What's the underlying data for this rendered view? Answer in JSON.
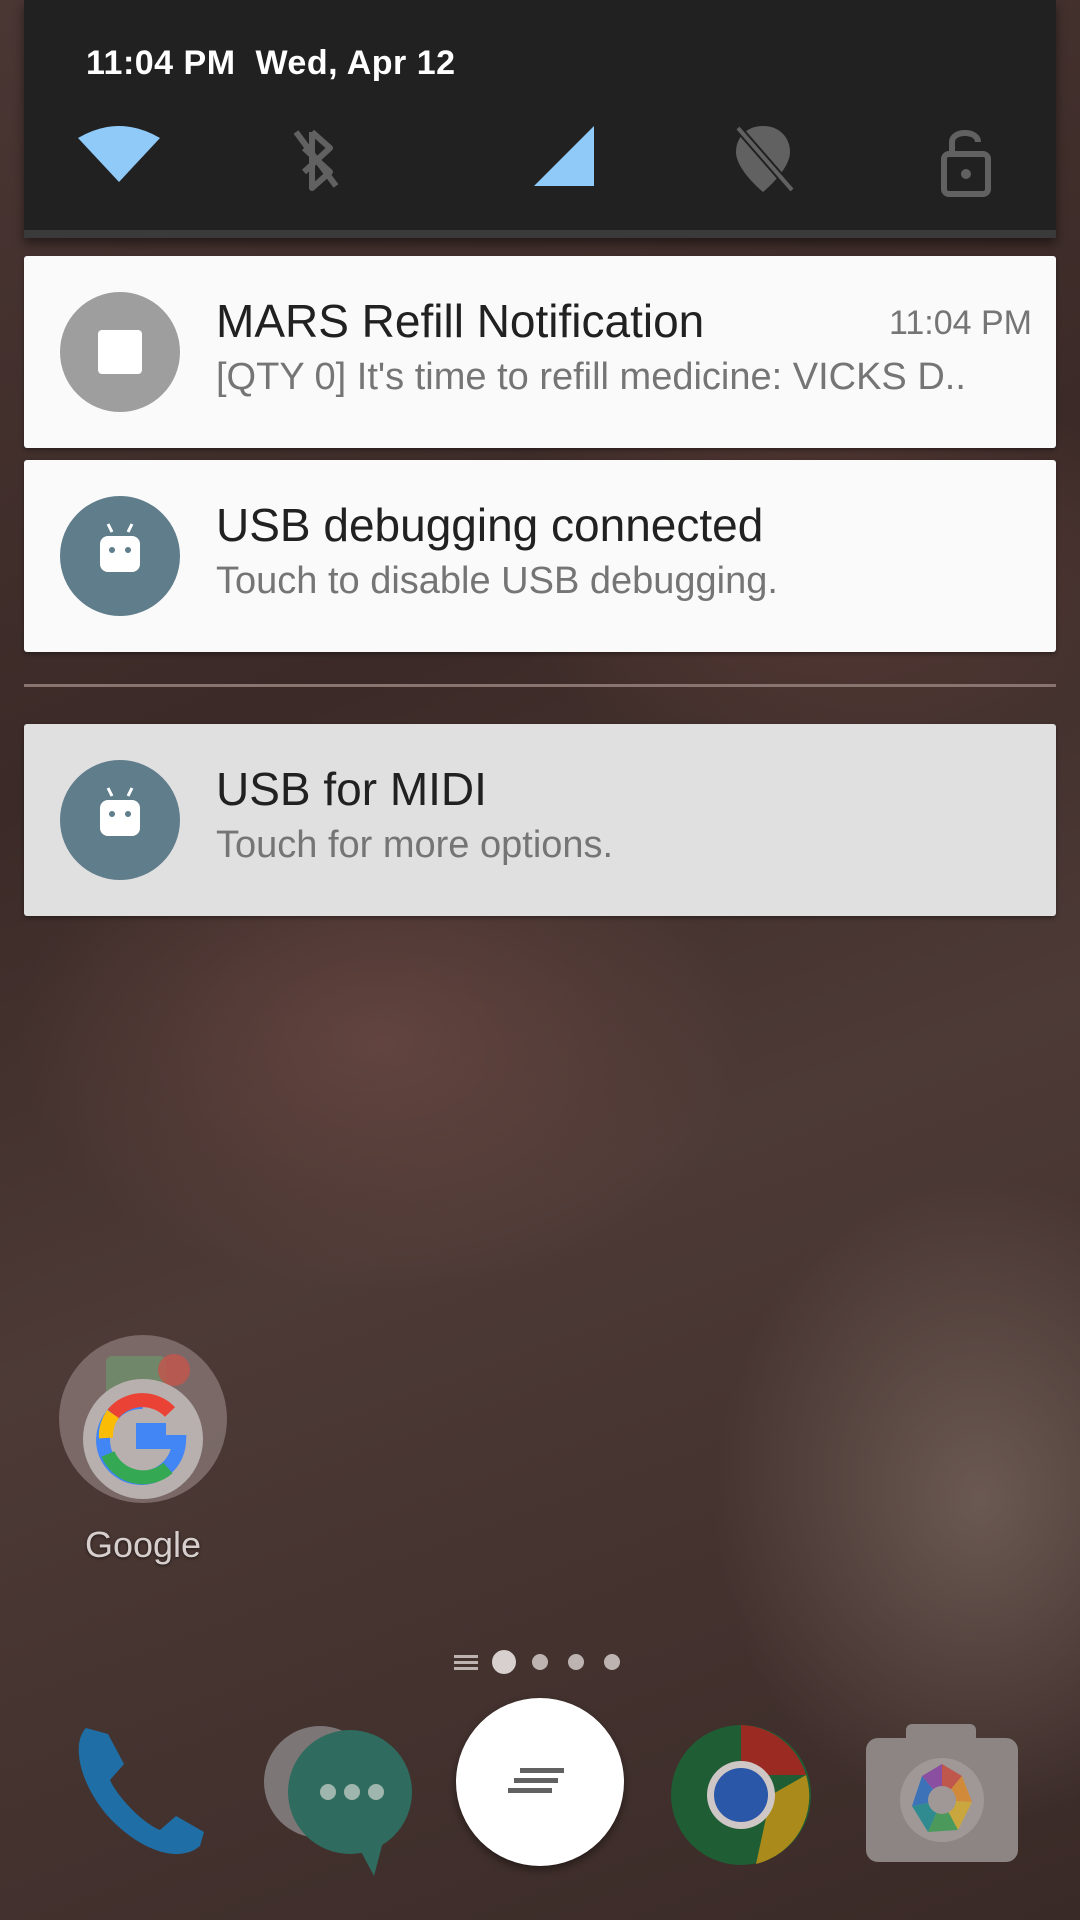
{
  "status_header": {
    "time": "11:04 PM",
    "date": "Wed, Apr 12"
  },
  "quick_settings": [
    {
      "name": "wifi-icon",
      "state": "on"
    },
    {
      "name": "bluetooth-off-icon",
      "state": "off"
    },
    {
      "name": "cellular-signal-icon",
      "state": "on"
    },
    {
      "name": "location-off-icon",
      "state": "off"
    },
    {
      "name": "lock-icon",
      "state": "off"
    }
  ],
  "notifications": [
    {
      "title": "MARS Refill Notification",
      "body": "[QTY 0] It's time to refill medicine: VICKS D..",
      "time": "11:04 PM",
      "icon": "stop-icon",
      "icon_color": "#9e9e9e"
    },
    {
      "title": "USB debugging connected",
      "body": "Touch to disable USB debugging.",
      "icon": "android-icon",
      "icon_color": "#607d8b"
    },
    {
      "title": "USB for MIDI",
      "body": "Touch for more options.",
      "icon": "android-icon",
      "icon_color": "#607d8b"
    }
  ],
  "home": {
    "folder_label": "Google",
    "page_indicator": {
      "pages": 4,
      "current": 1
    },
    "dock": [
      {
        "name": "phone-icon"
      },
      {
        "name": "messenger-icon"
      },
      {
        "name": "app-drawer-icon"
      },
      {
        "name": "chrome-icon"
      },
      {
        "name": "camera-icon"
      }
    ]
  },
  "colors": {
    "quick_settings_bg": "#212121",
    "icon_on": "#90caf9",
    "icon_off": "#616161",
    "card_bg": "#fafafa",
    "card_dim_bg": "#e0e0e0"
  }
}
